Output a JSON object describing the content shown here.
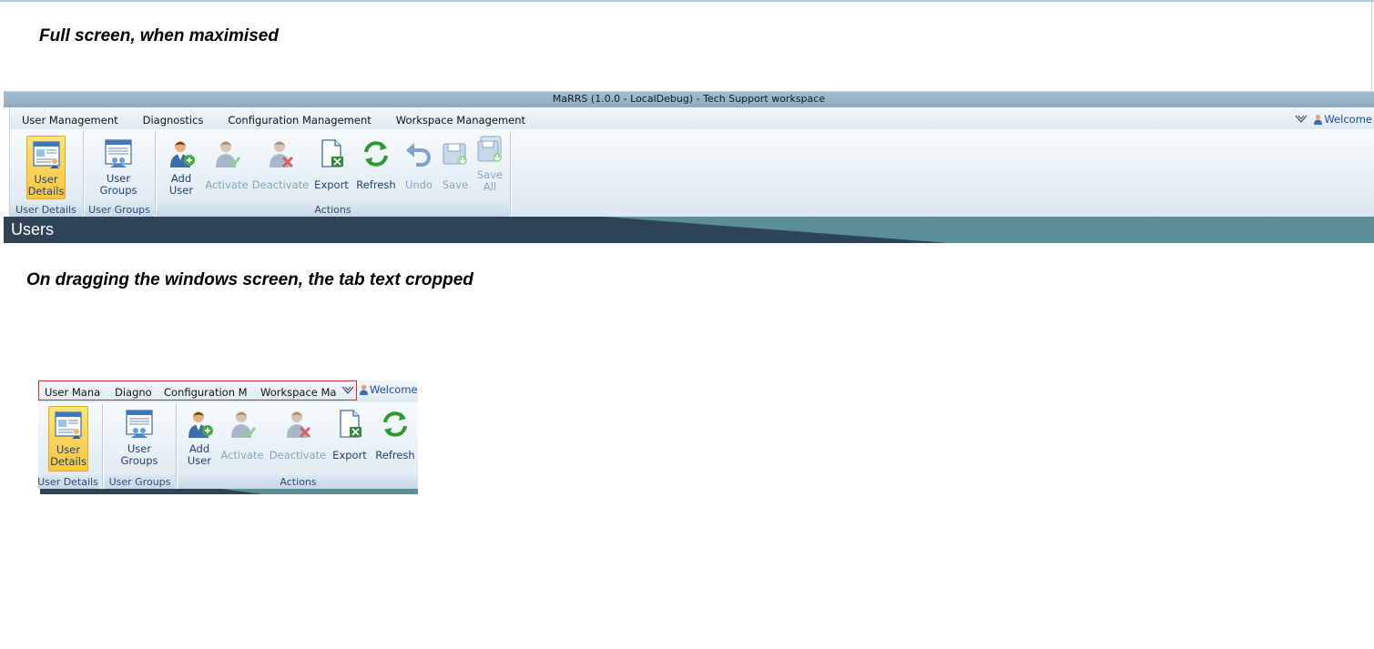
{
  "captions": {
    "maximised": "Full screen, when maximised",
    "dragged": "On dragging the windows screen, the tab text cropped"
  },
  "window": {
    "title": "MaRRS (1.0.0 - LocalDebug) - Tech Support workspace",
    "tabs": [
      "User Management",
      "Diagnostics",
      "Configuration Management",
      "Workspace Management"
    ],
    "welcome": "Welcome",
    "ribbon": {
      "groups": [
        {
          "label": "User Details",
          "buttons": [
            {
              "label": "User\nDetails",
              "icon": "user-details-icon",
              "active": true
            }
          ]
        },
        {
          "label": "User Groups",
          "buttons": [
            {
              "label": "User\nGroups",
              "icon": "user-groups-icon"
            }
          ]
        },
        {
          "label": "Actions",
          "buttons": [
            {
              "label": "Add\nUser",
              "icon": "add-user-icon"
            },
            {
              "label": "Activate",
              "icon": "activate-icon",
              "disabled": true
            },
            {
              "label": "Deactivate",
              "icon": "deactivate-icon",
              "disabled": true
            },
            {
              "label": "Export",
              "icon": "export-icon"
            },
            {
              "label": "Refresh",
              "icon": "refresh-icon"
            },
            {
              "label": "Undo",
              "icon": "undo-icon",
              "disabled": true
            },
            {
              "label": "Save",
              "icon": "save-icon",
              "disabled": true
            },
            {
              "label": "Save\nAll",
              "icon": "save-all-icon",
              "disabled": true
            }
          ]
        }
      ]
    },
    "page_title": "Users"
  },
  "small_window": {
    "tabs": [
      "User Manag",
      "Diagno",
      "Configuration Ma",
      "Workspace Mai"
    ],
    "welcome": "Welcome",
    "ribbon": {
      "groups": [
        {
          "label": "User Details",
          "buttons": [
            {
              "label": "User\nDetails",
              "active": true
            }
          ]
        },
        {
          "label": "User Groups",
          "buttons": [
            {
              "label": "User\nGroups"
            }
          ]
        },
        {
          "label": "Actions",
          "buttons": [
            {
              "label": "Add\nUser"
            },
            {
              "label": "Activate",
              "disabled": true
            },
            {
              "label": "Deactivate",
              "disabled": true
            },
            {
              "label": "Export"
            },
            {
              "label": "Refresh"
            }
          ]
        }
      ]
    }
  },
  "colors": {
    "accent_active": "#f7c640",
    "banner_dark": "#2f4356",
    "banner_teal": "#5b8f96",
    "crop_highlight": "#d12b2b"
  }
}
